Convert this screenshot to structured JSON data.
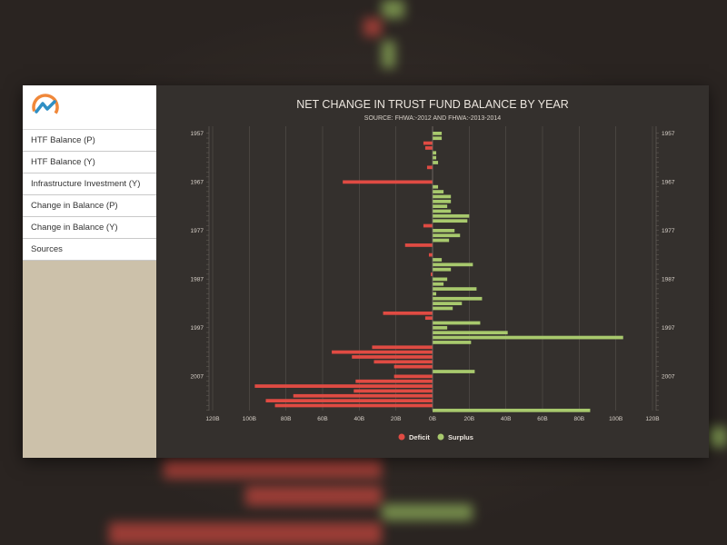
{
  "sidebar": {
    "logo": "logo-icon",
    "items": [
      {
        "label": "HTF Balance (P)"
      },
      {
        "label": "HTF Balance (Y)"
      },
      {
        "label": "Infrastructure Investment (Y)"
      },
      {
        "label": "Change in Balance (P)"
      },
      {
        "label": "Change in Balance (Y)"
      },
      {
        "label": "Sources"
      }
    ]
  },
  "colors": {
    "deficit": "#e04b43",
    "surplus": "#a8c96d",
    "sidebar_bg": "#ccc1aa",
    "panel_bg": "#34302d"
  },
  "chart_data": {
    "type": "bar",
    "orientation": "horizontal",
    "title": "NET CHANGE IN TRUST FUND BALANCE BY YEAR",
    "subtitle": "SOURCE: FHWA:-2012 AND FHWA:-2013-2014",
    "xlim": [
      -120,
      120
    ],
    "x_unit": "B",
    "x_ticks": [
      "120B",
      "100B",
      "80B",
      "60B",
      "40B",
      "20B",
      "0B",
      "20B",
      "40B",
      "60B",
      "80B",
      "100B",
      "120B"
    ],
    "y_tick_labels": [
      "1957",
      "1967",
      "1977",
      "1987",
      "1997",
      "2007"
    ],
    "y_axis": "right and left",
    "grid": true,
    "legend": {
      "position": "bottom",
      "entries": [
        "Deficit",
        "Surplus"
      ]
    },
    "years": [
      1957,
      1958,
      1959,
      1960,
      1961,
      1962,
      1963,
      1964,
      1965,
      1966,
      1967,
      1968,
      1969,
      1970,
      1971,
      1972,
      1973,
      1974,
      1975,
      1976,
      1977,
      1978,
      1979,
      1980,
      1981,
      1982,
      1983,
      1984,
      1985,
      1986,
      1987,
      1988,
      1989,
      1990,
      1991,
      1992,
      1993,
      1994,
      1995,
      1996,
      1997,
      1998,
      1999,
      2000,
      2001,
      2002,
      2003,
      2004,
      2005,
      2006,
      2007,
      2008,
      2009,
      2010,
      2011,
      2012,
      2013,
      2014
    ],
    "values": [
      5,
      5,
      -5,
      -4,
      2,
      2,
      3,
      -3,
      0,
      0,
      -49,
      3,
      6,
      10,
      10,
      8,
      10,
      20,
      19,
      -5,
      12,
      15,
      9,
      -15,
      0,
      -2,
      5,
      22,
      10,
      -1,
      8,
      6,
      24,
      2,
      27,
      16,
      11,
      -27,
      -4,
      26,
      8,
      41,
      104,
      21,
      -33,
      -55,
      -44,
      -32,
      -21,
      23,
      -21,
      -42,
      -97,
      -43,
      -76,
      -91,
      -86,
      86
    ]
  }
}
